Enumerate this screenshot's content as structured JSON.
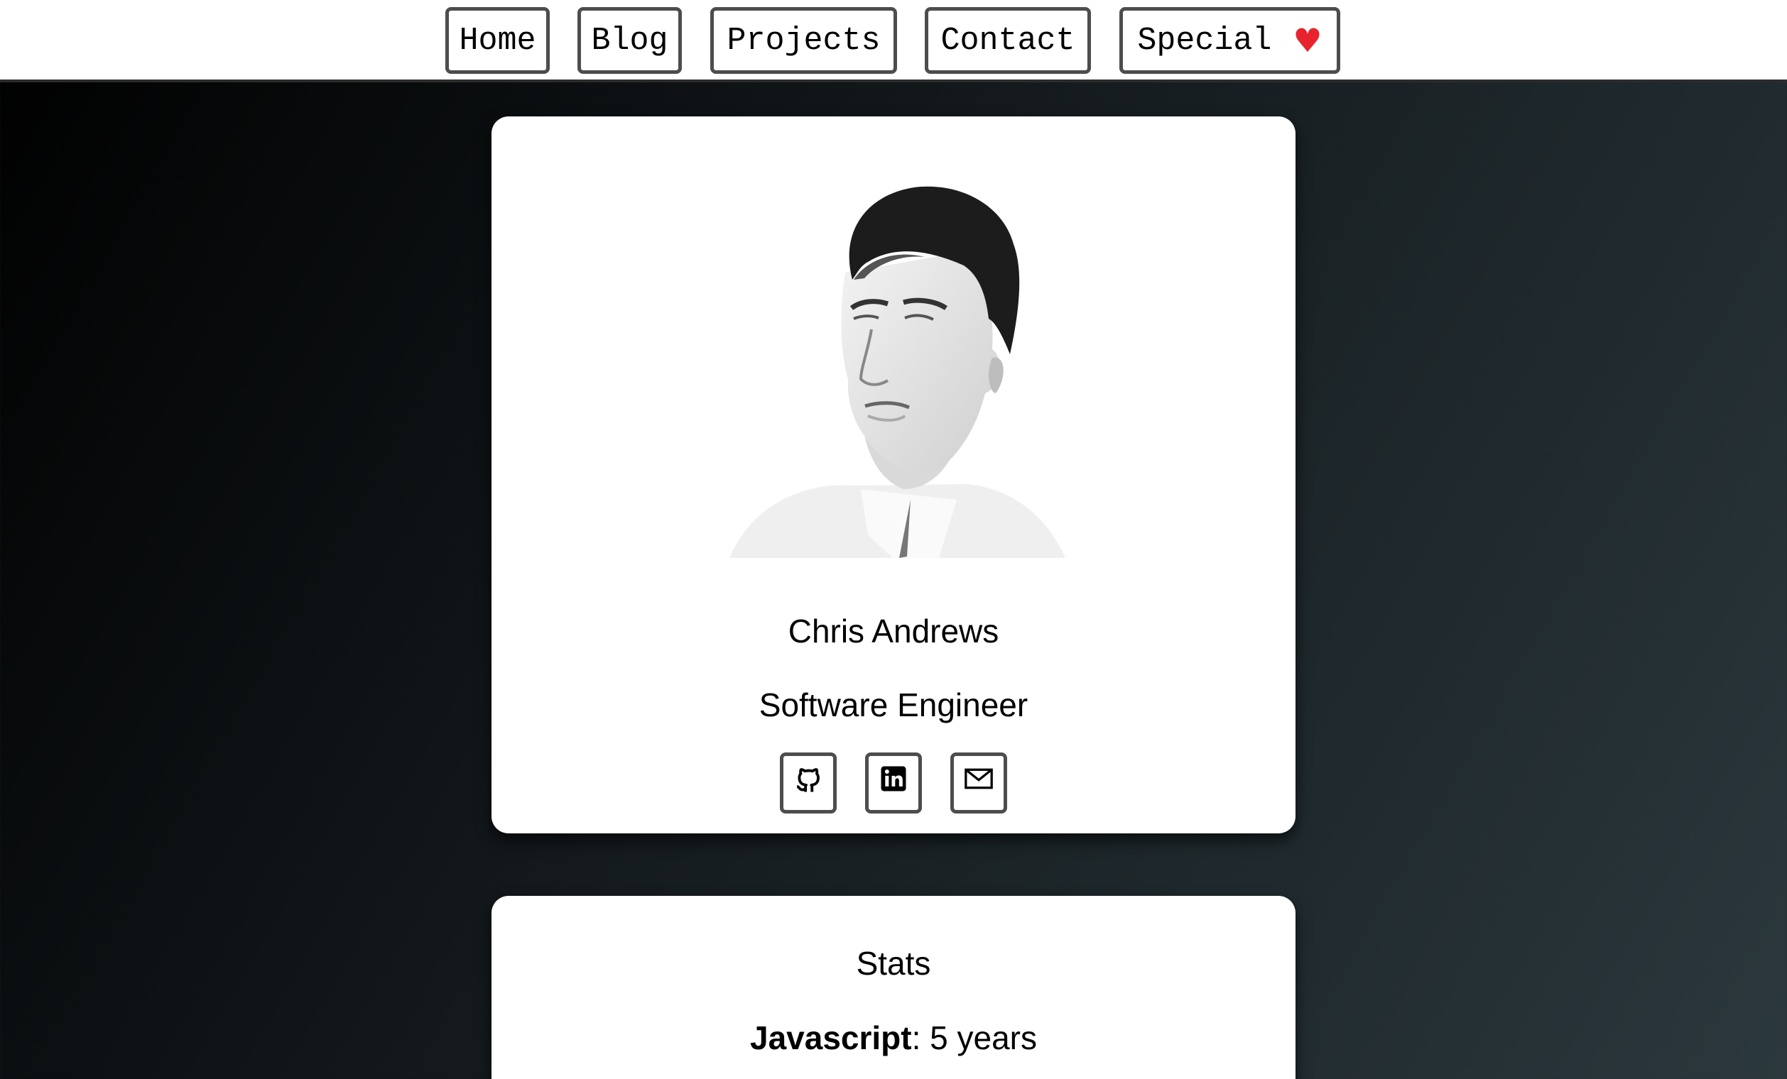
{
  "nav": {
    "home": "Home",
    "blog": "Blog",
    "projects": "Projects",
    "contact": "Contact",
    "special": "Special",
    "special_icon": "heart-icon"
  },
  "profile": {
    "name": "Chris Andrews",
    "role": "Software Engineer",
    "photo_icon": "profile-photo",
    "social": [
      {
        "icon": "github-icon"
      },
      {
        "icon": "linkedin-icon"
      },
      {
        "icon": "email-icon"
      }
    ]
  },
  "stats": {
    "title": "Stats",
    "items": [
      {
        "skill": "Javascript",
        "separator": ":",
        "value": " 5 years"
      }
    ]
  },
  "colors": {
    "heart": "#e8232f",
    "border": "#4d4d4d",
    "gradient_start": "#000000",
    "gradient_end": "#2b383d"
  }
}
